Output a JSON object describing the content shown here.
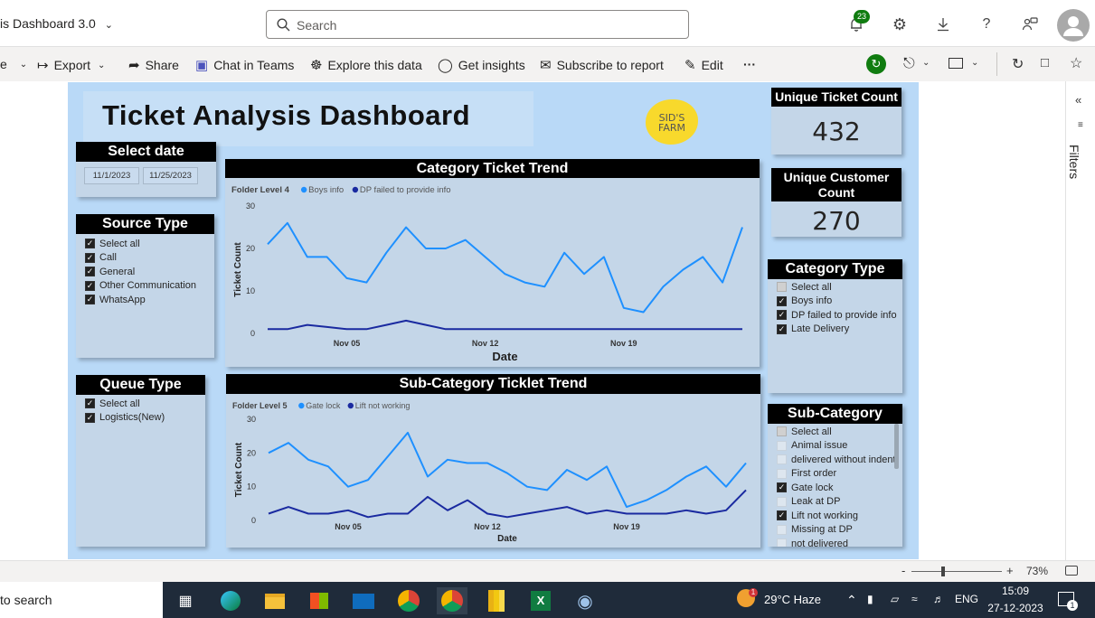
{
  "header": {
    "app_title": "is Dashboard 3.0",
    "search_placeholder": "Search",
    "notification_count": "23"
  },
  "actions": {
    "partial_left": "e",
    "export": "Export",
    "share": "Share",
    "chat": "Chat in Teams",
    "explore": "Explore this data",
    "insights": "Get insights",
    "subscribe": "Subscribe to report",
    "edit": "Edit",
    "more": "···"
  },
  "report": {
    "title": "Ticket Analysis Dashboard",
    "logo_line1": "SID'S",
    "logo_line2": "FARM",
    "select_date": {
      "title": "Select date",
      "start": "11/1/2023",
      "end": "11/25/2023"
    },
    "source_type": {
      "title": "Source Type",
      "items": [
        {
          "label": "Select all",
          "state": "on"
        },
        {
          "label": "Call",
          "state": "on"
        },
        {
          "label": "General",
          "state": "on"
        },
        {
          "label": "Other Communication",
          "state": "on"
        },
        {
          "label": "WhatsApp",
          "state": "on"
        }
      ]
    },
    "queue_type": {
      "title": "Queue Type",
      "items": [
        {
          "label": "Select all",
          "state": "on"
        },
        {
          "label": "Logistics(New)",
          "state": "on"
        }
      ]
    },
    "unique_ticket": {
      "title": "Unique Ticket Count",
      "value": "432"
    },
    "unique_customer": {
      "title_line1": "Unique Customer",
      "title_line2": "Count",
      "value": "270"
    },
    "category_type": {
      "title": "Category Type",
      "items": [
        {
          "label": "Select all",
          "state": "partial"
        },
        {
          "label": "Boys info",
          "state": "on"
        },
        {
          "label": "DP failed to provide info",
          "state": "on"
        },
        {
          "label": "Late Delivery",
          "state": "on"
        }
      ]
    },
    "sub_category": {
      "title": "Sub-Category",
      "items": [
        {
          "label": "Select all",
          "state": "partial"
        },
        {
          "label": "Animal issue",
          "state": "off"
        },
        {
          "label": "delivered without indent",
          "state": "off"
        },
        {
          "label": "First order",
          "state": "off"
        },
        {
          "label": "Gate lock",
          "state": "on"
        },
        {
          "label": "Leak at DP",
          "state": "off"
        },
        {
          "label": "Lift not working",
          "state": "on"
        },
        {
          "label": "Missing at DP",
          "state": "off"
        },
        {
          "label": "not delivered",
          "state": "off"
        }
      ]
    }
  },
  "filters_label": "Filters",
  "zoom": {
    "minus": "-",
    "plus": "+",
    "level": "73%"
  },
  "taskbar": {
    "search": "to search",
    "temp_badge": "1",
    "weather": "29°C  Haze",
    "lang": "ENG",
    "time": "15:09",
    "date": "27-12-2023",
    "notif": "1"
  },
  "colors": {
    "series_light": "#1e90ff",
    "series_dark": "#1a2aa0",
    "report_bg": "#b9d9f7",
    "panel_bg": "#c4d6e8"
  },
  "chart_data": [
    {
      "type": "line",
      "title": "Category Ticket Trend",
      "legend_title": "Folder Level 4",
      "xlabel": "Date",
      "ylabel": "Ticket Count",
      "x_ticks": [
        "Nov 05",
        "Nov 12",
        "Nov 19"
      ],
      "x": [
        "2023-11-01",
        "2023-11-02",
        "2023-11-03",
        "2023-11-04",
        "2023-11-05",
        "2023-11-06",
        "2023-11-07",
        "2023-11-08",
        "2023-11-09",
        "2023-11-10",
        "2023-11-11",
        "2023-11-12",
        "2023-11-13",
        "2023-11-14",
        "2023-11-15",
        "2023-11-16",
        "2023-11-17",
        "2023-11-18",
        "2023-11-19",
        "2023-11-20",
        "2023-11-21",
        "2023-11-22",
        "2023-11-23",
        "2023-11-24",
        "2023-11-25"
      ],
      "ylim": [
        0,
        30
      ],
      "y_ticks": [
        0,
        10,
        20,
        30
      ],
      "series": [
        {
          "name": "Boys info",
          "color": "#1e90ff",
          "values": [
            21,
            26,
            18,
            18,
            13,
            12,
            19,
            25,
            20,
            20,
            22,
            18,
            14,
            12,
            11,
            19,
            14,
            18,
            6,
            5,
            11,
            15,
            18,
            12,
            25
          ]
        },
        {
          "name": "DP failed to provide info",
          "color": "#1a2aa0",
          "values": [
            1,
            1,
            2,
            1.5,
            1,
            1,
            2,
            3,
            2,
            1,
            1,
            1,
            1,
            1,
            1,
            1,
            1,
            1,
            1,
            1,
            1,
            1,
            1,
            1,
            1
          ]
        }
      ]
    },
    {
      "type": "line",
      "title": "Sub-Category Ticklet Trend",
      "legend_title": "Folder Level 5",
      "xlabel": "Date",
      "ylabel": "Ticket Count",
      "x_ticks": [
        "Nov 05",
        "Nov 12",
        "Nov 19"
      ],
      "x": [
        "2023-11-01",
        "2023-11-02",
        "2023-11-03",
        "2023-11-04",
        "2023-11-05",
        "2023-11-06",
        "2023-11-07",
        "2023-11-08",
        "2023-11-09",
        "2023-11-10",
        "2023-11-11",
        "2023-11-12",
        "2023-11-13",
        "2023-11-14",
        "2023-11-15",
        "2023-11-16",
        "2023-11-17",
        "2023-11-18",
        "2023-11-19",
        "2023-11-20",
        "2023-11-21",
        "2023-11-22",
        "2023-11-23",
        "2023-11-24",
        "2023-11-25"
      ],
      "ylim": [
        0,
        30
      ],
      "y_ticks": [
        0,
        10,
        20,
        30
      ],
      "series": [
        {
          "name": "Gate lock",
          "color": "#1e90ff",
          "values": [
            20,
            23,
            18,
            16,
            10,
            12,
            19,
            26,
            13,
            18,
            17,
            17,
            14,
            10,
            9,
            15,
            12,
            16,
            4,
            6,
            9,
            13,
            16,
            10,
            17
          ]
        },
        {
          "name": "Lift not working",
          "color": "#1a2aa0",
          "values": [
            2,
            4,
            2,
            2,
            3,
            1,
            2,
            2,
            7,
            3,
            6,
            2,
            1,
            2,
            3,
            4,
            2,
            3,
            2,
            2,
            2,
            3,
            2,
            3,
            9
          ]
        }
      ]
    }
  ]
}
